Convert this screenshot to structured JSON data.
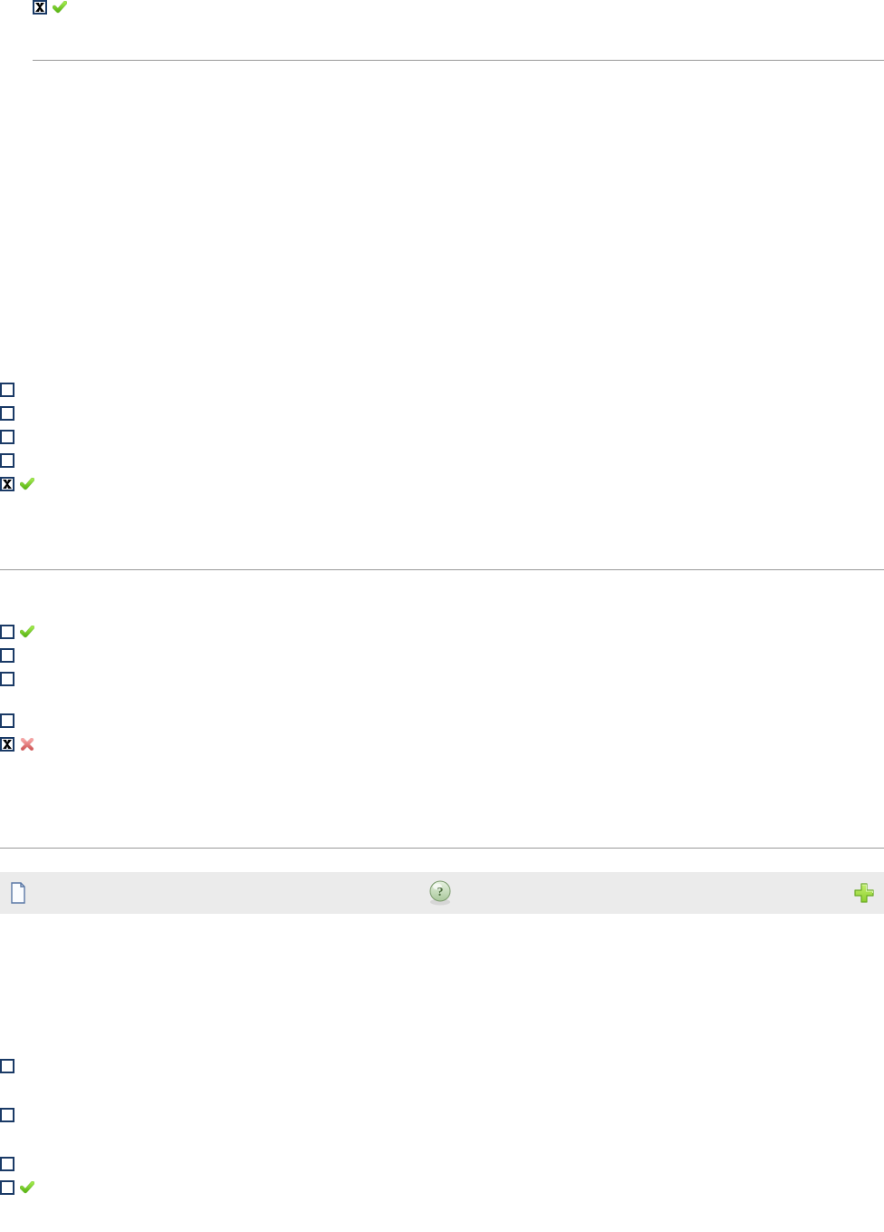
{
  "block1": {
    "items": [
      {
        "checked": true,
        "icon": "check"
      }
    ]
  },
  "block2": {
    "items": [
      {
        "checked": false,
        "icon": null
      },
      {
        "checked": false,
        "icon": null
      },
      {
        "checked": false,
        "icon": null
      },
      {
        "checked": false,
        "icon": null
      },
      {
        "checked": true,
        "icon": "check"
      }
    ]
  },
  "block3a": {
    "items": [
      {
        "checked": false,
        "icon": "check"
      },
      {
        "checked": false,
        "icon": null
      },
      {
        "checked": false,
        "icon": null
      }
    ]
  },
  "block3b": {
    "items": [
      {
        "checked": false,
        "icon": null
      },
      {
        "checked": true,
        "icon": "x"
      }
    ]
  },
  "toolbar": {
    "page_icon": "page-icon",
    "help_icon": "help-icon",
    "add_icon": "plus-icon"
  },
  "block4": {
    "items": [
      {
        "checked": false,
        "icon": null,
        "gap_after": true
      },
      {
        "checked": false,
        "icon": null,
        "gap_after": true
      },
      {
        "checked": false,
        "icon": null,
        "gap_after": false
      },
      {
        "checked": false,
        "icon": "check",
        "gap_after": false
      }
    ]
  }
}
